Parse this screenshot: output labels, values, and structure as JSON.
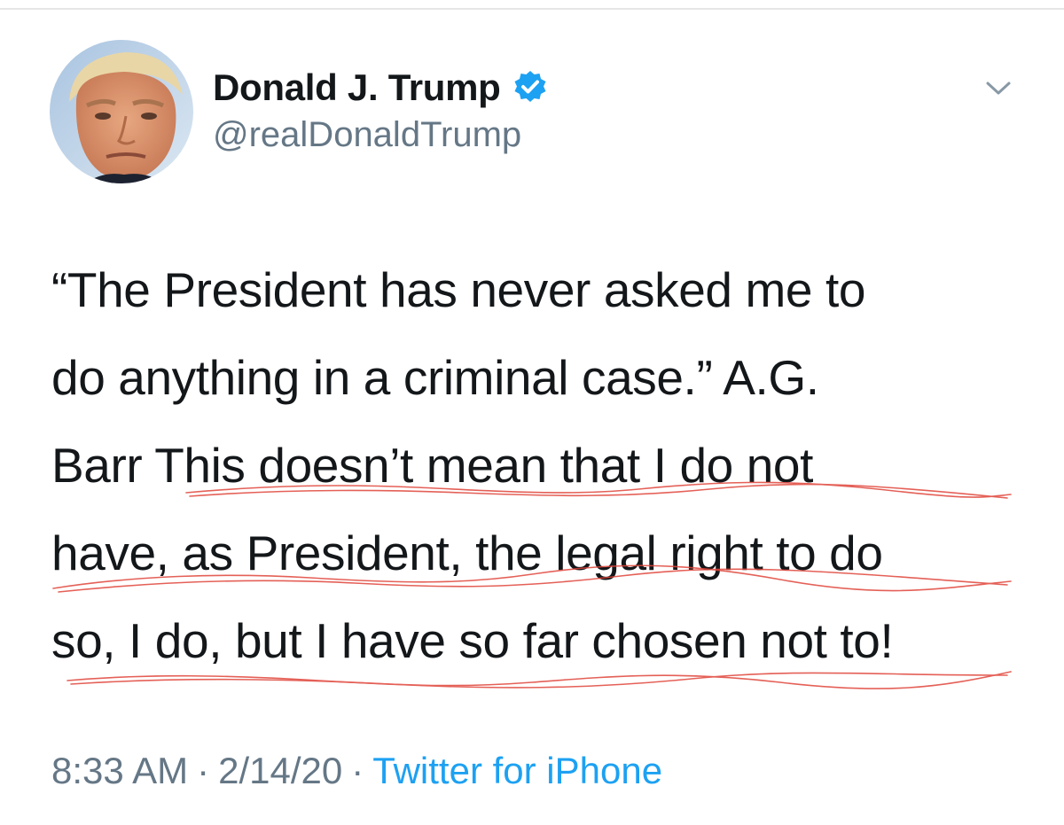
{
  "author": {
    "display_name": "Donald J. Trump",
    "handle": "@realDonaldTrump",
    "verified": true,
    "avatar_icon": "profile-photo"
  },
  "tweet": {
    "lines": [
      "“The President has never asked me to",
      "do anything in a criminal case.” A.G.",
      "Barr  This doesn’t mean that I do not",
      "have, as President, the legal right to do",
      "so, I do, but I have so far chosen not to!"
    ]
  },
  "meta": {
    "time": "8:33 AM",
    "separator": "·",
    "date": "2/14/20",
    "source": "Twitter for iPhone"
  },
  "icons": {
    "verified": "verified-badge-icon",
    "menu": "chevron-down-icon"
  },
  "colors": {
    "text": "#14171a",
    "secondary": "#657786",
    "accent": "#1da1f2",
    "annotation": "#e0453a"
  }
}
